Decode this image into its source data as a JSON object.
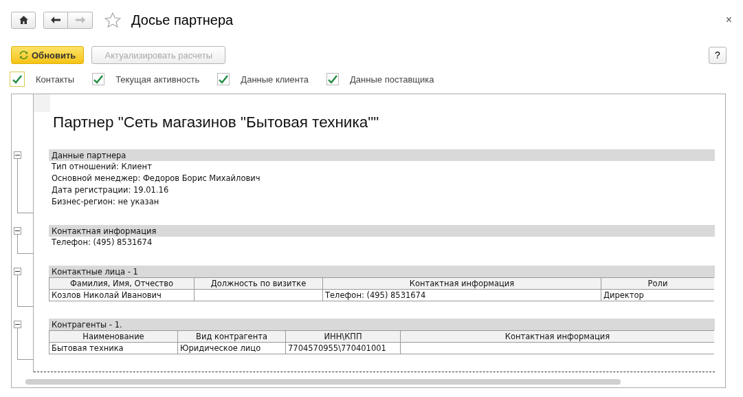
{
  "window": {
    "title": "Досье партнера",
    "favorite": false,
    "nav": {
      "back_disabled": false,
      "forward_disabled": true
    },
    "close": "×"
  },
  "buttons": [
    {
      "label": "Обновить",
      "kind": "primary",
      "disabled": false
    },
    {
      "label": "Актуализировать расчеты",
      "kind": "normal",
      "disabled": true
    }
  ],
  "help": "?",
  "options": [
    {
      "label": "Контакты",
      "checked": true,
      "focused": true
    },
    {
      "label": "Текущая активность",
      "checked": true,
      "focused": false
    },
    {
      "label": "Данные клиента",
      "checked": true,
      "focused": false
    },
    {
      "label": "Данные поставщика",
      "checked": true,
      "focused": false
    }
  ],
  "report": {
    "title": "Партнер \"Сеть магазинов \"Бытовая техника\"\"",
    "sections": [
      {
        "title": "Данные партнера",
        "kind": "lines",
        "expanded": true,
        "lines": [
          "Тип отношений: Клиент",
          "Основной менеджер: Федоров Борис Михайлович",
          "Дата регистрации: 19.01.16",
          "Бизнес-регион: не указан"
        ]
      },
      {
        "title": "Контактная информация",
        "kind": "lines",
        "expanded": true,
        "lines": [
          "Телефон: (495) 8531674"
        ]
      },
      {
        "title": "Контактные лица - 1",
        "kind": "table",
        "expanded": true,
        "columns": [
          "Фамилия, Имя, Отчество",
          "Должность по визитке",
          "Контактная информация",
          "Роли"
        ],
        "rows": [
          [
            "Козлов Николай Иванович",
            "",
            "Телефон: (495) 8531674",
            "Директор"
          ]
        ]
      },
      {
        "title": "Контрагенты - 1.",
        "kind": "table",
        "expanded": true,
        "columns": [
          "Наименование",
          "Вид контрагента",
          "ИНН\\КПП",
          "Контактная информация"
        ],
        "rows": [
          [
            "Бытовая техника",
            "Юридическое лицо",
            "7704570955\\770401001",
            ""
          ]
        ]
      }
    ]
  }
}
